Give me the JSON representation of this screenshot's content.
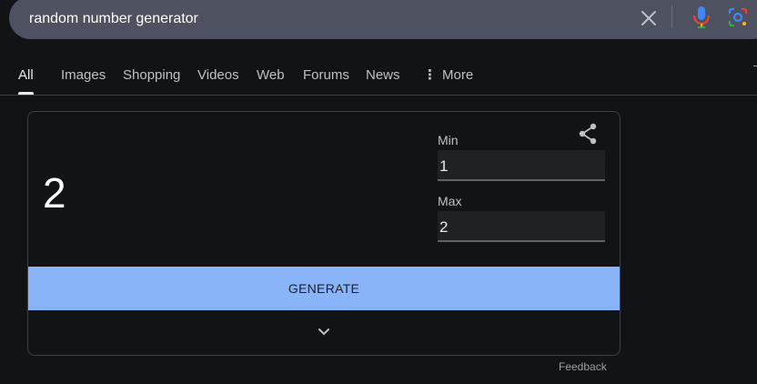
{
  "search": {
    "query": "random number generator"
  },
  "tabs": [
    {
      "label": "All",
      "active": true
    },
    {
      "label": "Images"
    },
    {
      "label": "Shopping"
    },
    {
      "label": "Videos"
    },
    {
      "label": "Web"
    },
    {
      "label": "Forums"
    },
    {
      "label": "News"
    },
    {
      "label": "More"
    }
  ],
  "generator": {
    "result": "2",
    "min_label": "Min",
    "min_value": "1",
    "max_label": "Max",
    "max_value": "2",
    "generate_label": "GENERATE"
  },
  "footer": {
    "feedback_label": "Feedback"
  },
  "icons": {
    "clear": "close-icon",
    "mic": "mic-icon",
    "lens": "lens-icon",
    "share": "share-icon",
    "expand": "chevron-down-icon"
  },
  "colors": {
    "accent_button": "#8ab4f8",
    "search_bg": "#4d5160",
    "page_bg": "#121317"
  }
}
